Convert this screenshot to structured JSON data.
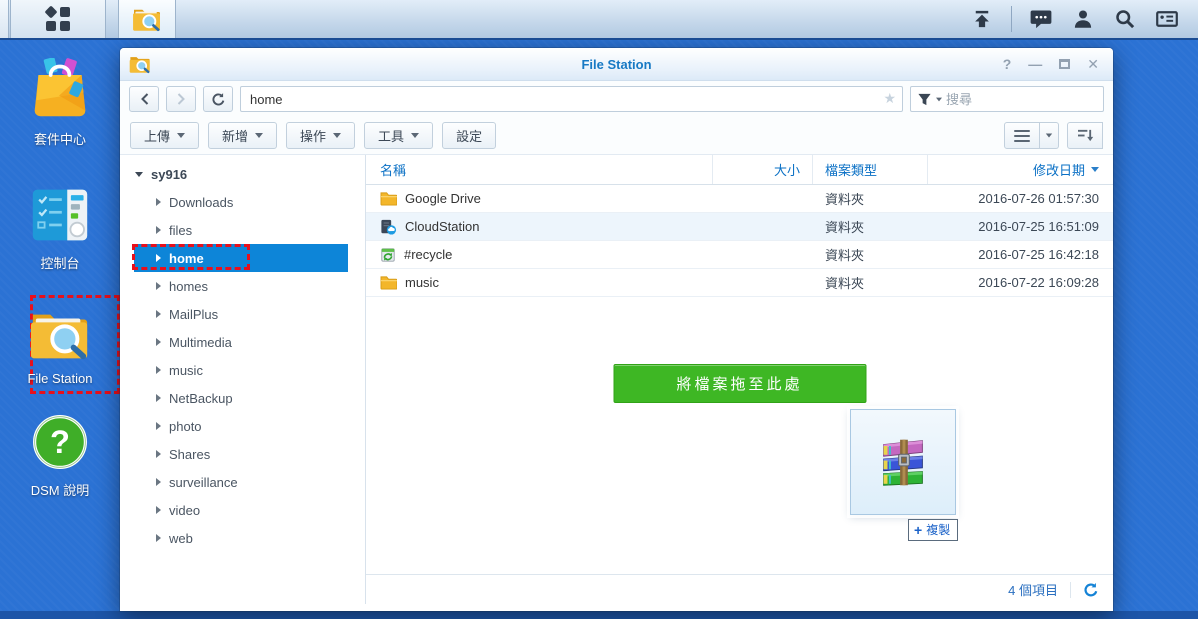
{
  "colors": {
    "desktop_blue": "#2b72d4",
    "selection_blue": "#0d85d8",
    "title_blue": "#1779c4",
    "header_blue": "#0a70c5",
    "dropzone_green": "#3eb724",
    "annotation_red": "#e8101c",
    "status_blue": "#2a6fc0"
  },
  "icons": {
    "taskbar": [
      "main-menu-icon",
      "file-station-icon",
      "pilot-view-icon",
      "notifications-icon",
      "user-options-icon",
      "search-icon",
      "widgets-icon"
    ],
    "window": [
      "help-icon",
      "minimize-icon",
      "maximize-icon",
      "close-icon",
      "back-icon",
      "forward-icon",
      "refresh-icon",
      "star-icon",
      "filter-funnel-icon",
      "list-view-icon",
      "sort-icon"
    ],
    "rows": [
      "folder-icon",
      "cloud-folder-icon",
      "recycle-bin-icon",
      "folder-icon"
    ],
    "drag": "winrar-archive-icon"
  },
  "desktop": {
    "icons": [
      {
        "label": "套件中心"
      },
      {
        "label": "控制台"
      },
      {
        "label": "File Station"
      },
      {
        "label": "DSM 說明"
      }
    ]
  },
  "window": {
    "title": "File Station",
    "controls": {
      "help": "?",
      "minimize": "—",
      "close": "✕"
    },
    "nav": {
      "address_value": "home",
      "star_glyph": "★",
      "search_placeholder": "搜尋"
    },
    "toolbar": {
      "buttons": [
        "上傳",
        "新增",
        "操作",
        "工具",
        "設定"
      ]
    },
    "tree": {
      "root": "sy916",
      "selected": "home",
      "items": [
        "Downloads",
        "files",
        "home",
        "homes",
        "MailPlus",
        "Multimedia",
        "music",
        "NetBackup",
        "photo",
        "Shares",
        "surveillance",
        "video",
        "web"
      ]
    },
    "files": {
      "columns": [
        "名稱",
        "大小",
        "檔案類型",
        "修改日期"
      ],
      "rows": [
        {
          "name": "Google Drive",
          "size": "",
          "type": "資料夾",
          "modified": "2016-07-26 01:57:30"
        },
        {
          "name": "CloudStation",
          "size": "",
          "type": "資料夾",
          "modified": "2016-07-25 16:51:09"
        },
        {
          "name": "#recycle",
          "size": "",
          "type": "資料夾",
          "modified": "2016-07-25 16:42:18"
        },
        {
          "name": "music",
          "size": "",
          "type": "資料夾",
          "modified": "2016-07-22 16:09:28"
        }
      ]
    },
    "dropzone": {
      "label": "將檔案拖至此處"
    },
    "drag": {
      "plus": "+",
      "badge": "複製"
    },
    "status": {
      "items_text": "4 個項目"
    }
  }
}
